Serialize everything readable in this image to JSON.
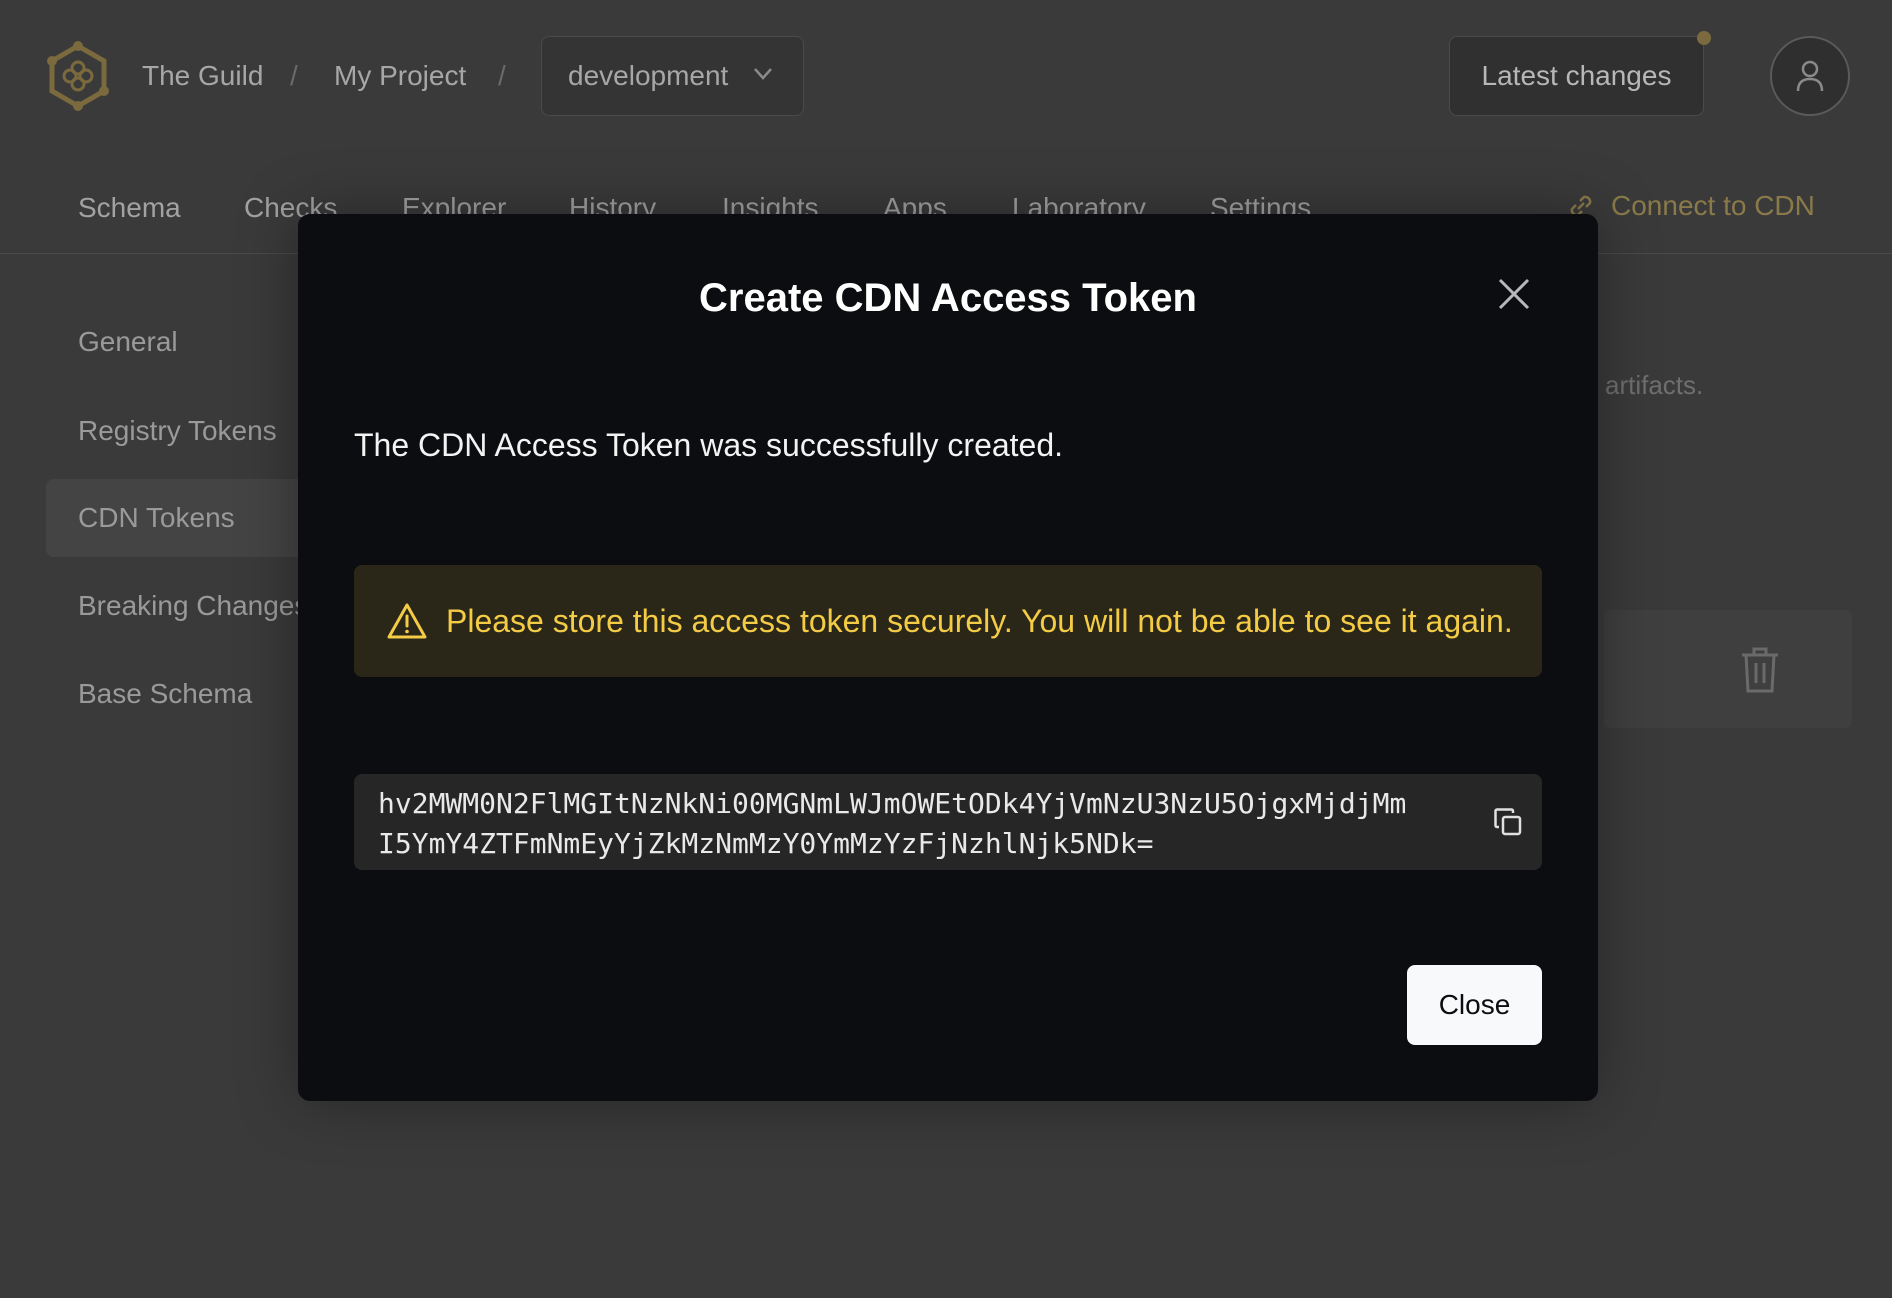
{
  "header": {
    "org": "The Guild",
    "project": "My Project",
    "separator": "/",
    "environment": "development",
    "latest_changes": "Latest changes"
  },
  "nav": {
    "tabs": [
      "Schema",
      "Checks",
      "Explorer",
      "History",
      "Insights",
      "Apps",
      "Laboratory",
      "Settings"
    ],
    "connect_cdn": "Connect to CDN"
  },
  "sidebar": {
    "items": [
      {
        "label": "General",
        "active": false
      },
      {
        "label": "Registry Tokens",
        "active": false
      },
      {
        "label": "CDN Tokens",
        "active": true
      },
      {
        "label": "Breaking Changes",
        "active": false
      },
      {
        "label": "Base Schema",
        "active": false
      }
    ]
  },
  "background": {
    "description_fragment": "artifacts."
  },
  "modal": {
    "title": "Create CDN Access Token",
    "message": "The CDN Access Token was successfully created.",
    "warning": "Please store this access token securely. You will not be able to see it again.",
    "token": "hv2MWM0N2FlMGItNzNkNi00MGNmLWJmOWEtODk4YjVmNzU3NzU5OjgxMjdjMmI5YmY4ZTFmNmEyYjZkMzNmMzY0YmMzYzFjNzhlNjk5NDk=",
    "close_button": "Close"
  },
  "colors": {
    "warning_text": "#f4cb45",
    "warning_bg": "#2a2718",
    "modal_bg": "#0c0d10",
    "accent": "#8a7a4a"
  },
  "icons": [
    "hive-logo-icon",
    "chevron-down-icon",
    "user-icon",
    "link-icon",
    "trash-icon",
    "close-icon",
    "warning-icon",
    "copy-icon"
  ]
}
